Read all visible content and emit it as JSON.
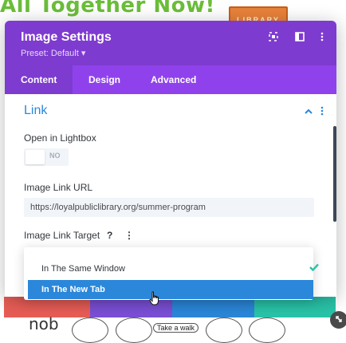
{
  "background": {
    "headline": "All Together Now!",
    "book_label": "LIBRARY",
    "bottom_text": "nob",
    "walk_label": "Take a walk"
  },
  "modal": {
    "title": "Image Settings",
    "preset": "Preset: Default ▾",
    "header_icons": [
      "expand-icon",
      "sidebar-icon",
      "more-icon"
    ],
    "tabs": [
      {
        "label": "Content",
        "active": true
      },
      {
        "label": "Design",
        "active": false
      },
      {
        "label": "Advanced",
        "active": false
      }
    ]
  },
  "section": {
    "title": "Link",
    "open_in_lightbox_label": "Open in Lightbox",
    "toggle_value": "NO",
    "image_link_url_label": "Image Link URL",
    "image_link_url_value": "https://loyalpubliclibrary.org/summer-program",
    "image_link_target_label": "Image Link Target",
    "help_glyph": "?",
    "more_glyph": "⋮"
  },
  "dropdown": {
    "options": [
      "In The Same Window",
      "In The New Tab"
    ],
    "checked_index": 0,
    "highlighted_index": 1
  },
  "colors": {
    "header_purple": "#7e3bd0",
    "tab_purple": "#8f42ec",
    "accent_blue": "#2b87da",
    "check_green": "#29c4a9"
  }
}
